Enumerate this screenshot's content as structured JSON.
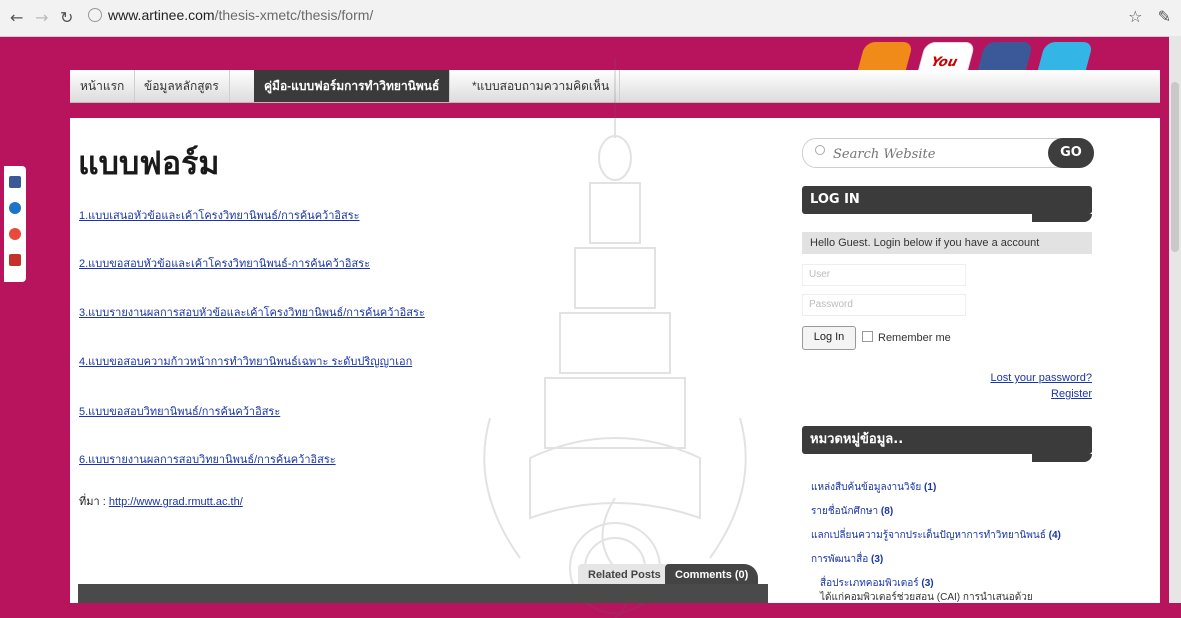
{
  "browser": {
    "url_domain": "www.artinee.com",
    "url_path": "/thesis-xmetc/thesis/form/"
  },
  "nav": {
    "items": [
      {
        "label": "หน้าแรก"
      },
      {
        "label": "ข้อมูลหลักสูตร"
      },
      {
        "label": "คู่มือ-แบบฟอร์มการทำวิทยานิพนธ์"
      },
      {
        "label": "*แบบสอบถามความคิดเห็น"
      }
    ]
  },
  "main": {
    "title": "แบบฟอร์ม",
    "links": [
      "1.แบบเสนอหัวข้อและเค้าโครงวิทยานิพนธ์/การค้นคว้าอิสระ",
      "2.แบบขอสอบหัวข้อและเค้าโครงวิทยานิพนธ์-การค้นคว้าอิสระ",
      "3.แบบรายงานผลการสอบหัวข้อและเค้าโครงวิทยานิพนธ์/การค้นคว้าอิสระ",
      "4.แบบขอสอบความก้าวหน้าการทำวิทยานิพนธ์เฉพาะ ระดับปริญญาเอก",
      "5.แบบขอสอบวิทยานิพนธ์/การค้นคว้าอิสระ",
      "6.แบบรายงานผลการสอบวิทยานิพนธ์/การค้นคว้าอิสระ"
    ],
    "source_label": "ที่มา :",
    "source_link": "http://www.grad.rmutt.ac.th/",
    "tabs": {
      "related": "Related Posts",
      "comments": "Comments (0)"
    }
  },
  "sidebar": {
    "search_placeholder": "Search Website",
    "search_button": "GO",
    "login_heading": "LOG IN",
    "hello": "Hello Guest. Login below if you have a account",
    "user_placeholder": "User",
    "password_placeholder": "Password",
    "login_button": "Log In",
    "remember": "Remember me",
    "lost_password": "Lost your password?",
    "register": "Register",
    "categories_heading": "หมวดหมู่ข้อมูล..",
    "categories": [
      {
        "name": "แหล่งสืบค้นข้อมูลงานวิจัย",
        "count": "(1)"
      },
      {
        "name": "รายชื่อนักศึกษา",
        "count": "(8)"
      },
      {
        "name": "แลกเปลี่ยนความรู้จากประเด็นปัญหาการทำวิทยานิพนธ์",
        "count": "(4)"
      },
      {
        "name": "การพัฒนาสื่อ",
        "count": "(3)"
      }
    ],
    "sub_category": {
      "name": "สื่อประเภทคอมพิวเตอร์",
      "count": "(3)"
    },
    "sub_text": "ได้แก่คอมพิวเตอร์ช่วยสอน (CAI) การนำเสนอด้วย"
  },
  "colors": {
    "background": "#b8135d",
    "nav_active": "#3a3a3a",
    "link": "#1a35a8"
  }
}
